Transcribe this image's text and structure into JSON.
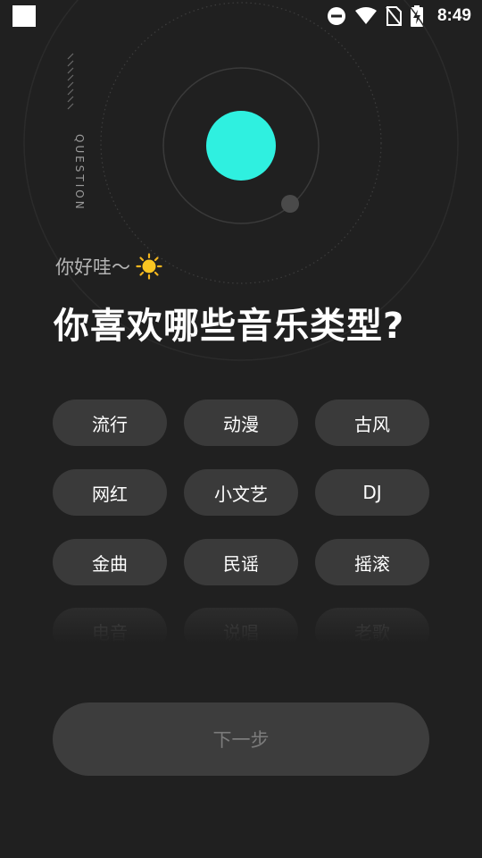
{
  "status_bar": {
    "time": "8:49",
    "icons": [
      "app-square-icon",
      "do-not-disturb-icon",
      "wifi-icon",
      "no-sim-icon",
      "battery-charging-icon"
    ]
  },
  "side_label": "QUESTION",
  "greeting": {
    "text": "你好哇～",
    "emoji": "sun-icon"
  },
  "headline": "你喜欢哪些音乐类型?",
  "genres": [
    {
      "label": "流行"
    },
    {
      "label": "动漫"
    },
    {
      "label": "古风"
    },
    {
      "label": "网红"
    },
    {
      "label": "小文艺"
    },
    {
      "label": "DJ"
    },
    {
      "label": "金曲"
    },
    {
      "label": "民谣"
    },
    {
      "label": "摇滚"
    }
  ],
  "genres_partial": [
    {
      "label": "电音"
    },
    {
      "label": "说唱"
    },
    {
      "label": "老歌"
    }
  ],
  "next_button": "下一步",
  "colors": {
    "accent": "#2ff0e0",
    "background": "#202020",
    "chip": "#3a3a3a"
  }
}
